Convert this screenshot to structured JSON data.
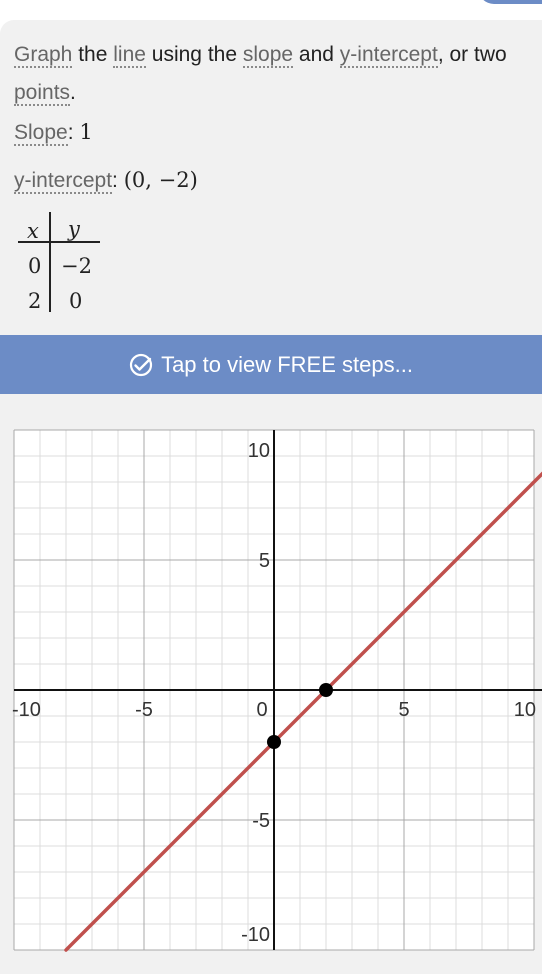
{
  "intro": {
    "w1": "Graph",
    "w2": " the ",
    "w3": "line",
    "w4": " using the ",
    "w5": "slope",
    "w6": " and ",
    "w7": "y-intercept",
    "w8": ", or two",
    "w9": "points",
    "w10": "."
  },
  "slope": {
    "label": "Slope",
    "sep": ": ",
    "value": "1"
  },
  "intercept": {
    "label": "y-intercept",
    "sep": ": ",
    "value": "(0, −2)"
  },
  "table": {
    "header_x": "x",
    "header_y": "y",
    "rows": [
      {
        "x": "0",
        "y": "−2"
      },
      {
        "x": "2",
        "y": "0"
      }
    ]
  },
  "steps_button": {
    "label": "Tap to view FREE steps..."
  },
  "colors": {
    "accent": "#6c8cc6",
    "line": "#c0504d",
    "point": "#000000"
  },
  "chart_data": {
    "type": "line",
    "equation": "y = x - 2",
    "x": [
      -8,
      10.5
    ],
    "y": [
      -10,
      8.5
    ],
    "points": [
      {
        "x": 0,
        "y": -2
      },
      {
        "x": 2,
        "y": 0
      }
    ],
    "xlim": [
      -10,
      10
    ],
    "ylim": [
      -10,
      10
    ],
    "xticks": [
      "-10",
      "-5",
      "0",
      "5",
      "10"
    ],
    "yticks": [
      "10",
      "5",
      "-5",
      "-10"
    ],
    "grid": true,
    "grid_step": 1,
    "major_step": 5
  }
}
